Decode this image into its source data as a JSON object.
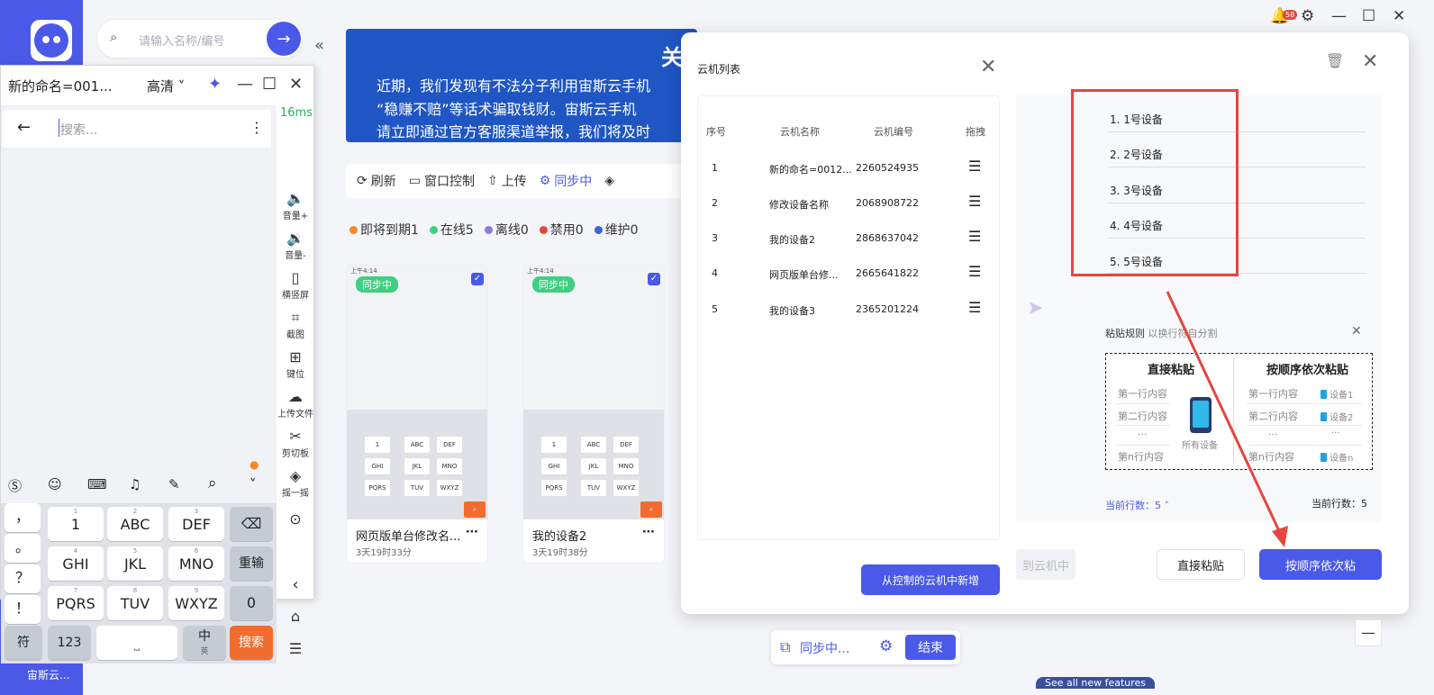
{
  "app": {
    "search_placeholder": "请输入名称/编号",
    "user_name": "宙斯云...",
    "notification_count": "58"
  },
  "banner": {
    "title": "关",
    "lines": [
      "近期，我们发现有不法分子利用宙斯云手机",
      "“稳赚不赔”等话术骗取钱财。宙斯云手机",
      "请立即通过官方客服渠道举报，我们将及时"
    ]
  },
  "toolbar": {
    "refresh": "刷新",
    "window_control": "窗口控制",
    "upload": "上传",
    "syncing": "同步中"
  },
  "status": {
    "expiring": "即将到期1",
    "online": "在线5",
    "offline": "离线0",
    "disabled": "禁用0",
    "maintenance": "维护0"
  },
  "cards": [
    {
      "badge": "同步中",
      "name": "网页版单台修改名...",
      "time": "3天19时33分",
      "status_bar": "上午4:14"
    },
    {
      "badge": "同步中",
      "name": "我的设备2",
      "time": "3天19时38分",
      "status_bar": "上午4:14"
    }
  ],
  "phone_window": {
    "title": "新的命名=001...",
    "quality": "高清",
    "ping": "16ms",
    "search_placeholder": "搜索...",
    "keys": {
      "row1": [
        "1",
        "ABC",
        "DEF"
      ],
      "row1_sub": [
        "1",
        "2",
        "3"
      ],
      "row2": [
        "GHI",
        "JKL",
        "MNO"
      ],
      "row2_sub": [
        "4",
        "5",
        "6"
      ],
      "row3": [
        "PQRS",
        "TUV",
        "WXYZ"
      ],
      "row3_sub": [
        "7",
        "8",
        "9"
      ],
      "side": [
        "，",
        "。",
        "？",
        "！"
      ],
      "reenter": "重输",
      "zero": "0",
      "symbol": "符",
      "num": "123",
      "lang": "中",
      "lang_sub": "英",
      "search": "搜索"
    },
    "tools": [
      "音量+",
      "音量-",
      "横竖屏",
      "截图",
      "键位",
      "上传文件",
      "剪切板",
      "摇一摇"
    ]
  },
  "dialog": {
    "title": "云机列表",
    "columns": [
      "序号",
      "云机名称",
      "云机编号",
      "拖拽"
    ],
    "rows": [
      {
        "idx": "1",
        "name": "新的命名=0012...",
        "id": "2260524935"
      },
      {
        "idx": "2",
        "name": "修改设备名称",
        "id": "2068908722"
      },
      {
        "idx": "3",
        "name": "我的设备2",
        "id": "2868637042"
      },
      {
        "idx": "4",
        "name": "网页版单台修...",
        "id": "2665641822"
      },
      {
        "idx": "5",
        "name": "我的设备3",
        "id": "2365201224"
      }
    ],
    "add_button": "从控制的云机中新增",
    "lines": [
      "1. 1号设备",
      "2. 2号设备",
      "3. 3号设备",
      "4. 4号设备",
      "5. 5号设备"
    ],
    "paste_rule_label": "粘贴规则",
    "paste_rule_sub": "以换行符自分割",
    "direct_title": "直接粘贴",
    "seq_title": "按顺序依次粘贴",
    "rule_lines": [
      "第一行内容",
      "第二行内容",
      "···",
      "第n行内容"
    ],
    "rule_devices": [
      "设备1",
      "设备2",
      "···",
      "设备n"
    ],
    "all_devices": "所有设备",
    "current_rows_left": "当前行数：5 ˄",
    "current_rows_right": "当前行数：5",
    "ghost_button": "到云机中",
    "direct_button": "直接粘贴",
    "seq_button": "按顺序依次粘"
  },
  "sync_bar": {
    "label": "同步中...",
    "end_button": "结束"
  },
  "bottom_strip": "See all new features",
  "colors": {
    "accent": "#4a59e8",
    "online": "#3fcf82",
    "expiring": "#f08a24",
    "disabled": "#e5463f",
    "highlight": "#e5463f"
  }
}
